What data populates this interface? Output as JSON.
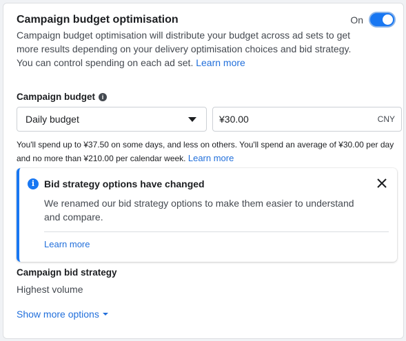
{
  "header": {
    "title": "Campaign budget optimisation",
    "toggle_label": "On",
    "toggle_state": true
  },
  "description": {
    "text": "Campaign budget optimisation will distribute your budget across ad sets to get more results depending on your delivery optimisation choices and bid strategy. You can control spending on each ad set.",
    "link": "Learn more"
  },
  "budget": {
    "label": "Campaign budget",
    "info_icon": "info-icon",
    "type_selected": "Daily budget",
    "amount": "¥30.00",
    "currency": "CNY",
    "note": "You'll spend up to ¥37.50 on some days, and less on others. You'll spend an average of ¥30.00 per day and no more than ¥210.00 per calendar week.",
    "note_link": "Learn more"
  },
  "notice": {
    "icon": "info-icon",
    "title": "Bid strategy options have changed",
    "body": "We renamed our bid strategy options to make them easier to understand and compare.",
    "link": "Learn more",
    "close_icon": "close-icon"
  },
  "bid_strategy": {
    "label": "Campaign bid strategy",
    "value": "Highest volume"
  },
  "show_more": {
    "label": "Show more options"
  },
  "colors": {
    "accent": "#1877f2",
    "link": "#216fdb",
    "text": "#1c1e21",
    "secondary_text": "#444950"
  }
}
